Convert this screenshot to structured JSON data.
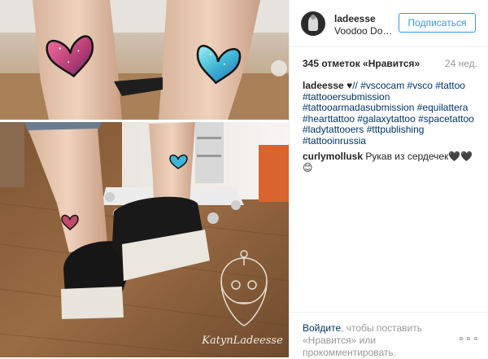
{
  "post": {
    "watermark_text": "KatynLadeesse"
  },
  "header": {
    "username": "ladeesse",
    "location": "Voodoo Do…",
    "follow_label": "Подписаться"
  },
  "stats": {
    "likes": "345 отметок «Нравится»",
    "time_ago": "24 нед."
  },
  "caption": {
    "username": "ladeesse",
    "emoji": "♥",
    "text": "// #vscocam #vsco #tattoo #tattooersubmission #tattooarmadasubmission #equilattera #hearttattoo #galaxytattoo #spacetattoo #ladytattooers #tttpublishing #tattooinrussia"
  },
  "comments": [
    {
      "username": "curlymollusk",
      "text": "Рукав из сердечек🖤🖤😊"
    }
  ],
  "footer": {
    "login_link": "Войдите",
    "login_rest": ", чтобы поставить «Нравится» или прокомментировать.",
    "more_icon": "ellipsis-icon"
  },
  "colors": {
    "link": "#003569",
    "accent": "#3897f0",
    "muted": "#999999"
  }
}
